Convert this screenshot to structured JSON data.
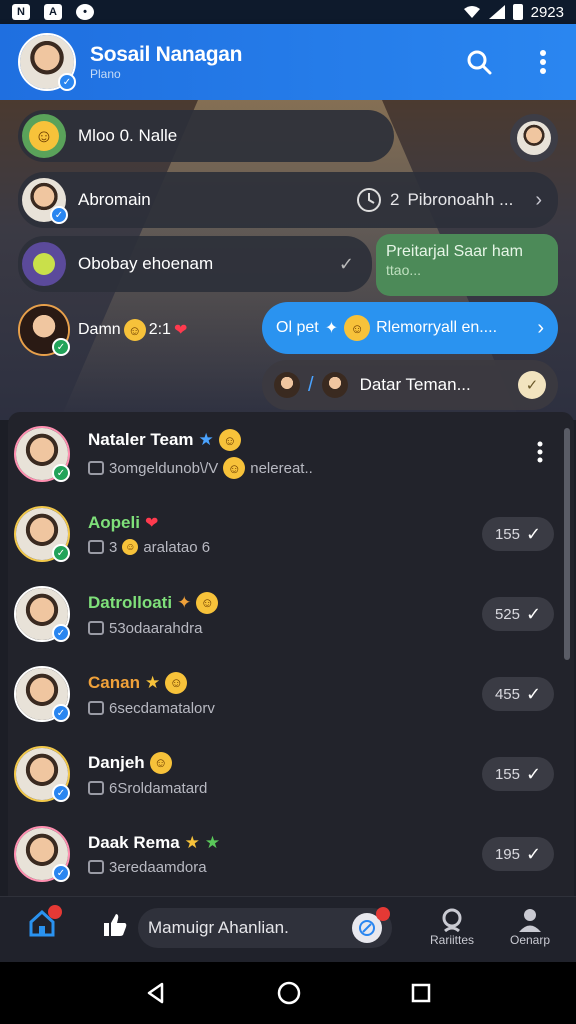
{
  "status_bar": {
    "time": "2923",
    "left_icons": [
      "N",
      "A",
      "•"
    ]
  },
  "header": {
    "title": "Sosail Nanagan",
    "subtitle": "Plano"
  },
  "conversation": {
    "row1": {
      "text": "Mloo 0. Nalle"
    },
    "row2": {
      "name": "Abromain",
      "preview": "Pibronoahh ...",
      "number": "2"
    },
    "row3": {
      "text": "Obobay ehoenam",
      "bubble_text": "Preitarjal Saar ham",
      "bubble_sub": "ttao..."
    },
    "row4": {
      "text": "Damn",
      "count": "2:1"
    },
    "blue_bubble": {
      "text_a": "Ol pet",
      "text_b": "Rlemorryall en...."
    },
    "row5": {
      "text": "Datar Teman..."
    }
  },
  "friends": [
    {
      "name": "Nataler Team",
      "name_color": "#ffffff",
      "sub": "3omgeldunob\\/V",
      "sub2": "nelereat..",
      "count": "",
      "verify": "green"
    },
    {
      "name": "Aopeli",
      "name_color": "#7fe07a",
      "sub": "3",
      "sub2": "aralatao 6",
      "count": "155",
      "verify": "green"
    },
    {
      "name": "Datrolloati",
      "name_color": "#7fe07a",
      "sub": "53odaarahdra",
      "sub2": "",
      "count": "525",
      "verify": "blue"
    },
    {
      "name": "Canan",
      "name_color": "#f0a13a",
      "sub": "6secdamatalorv",
      "sub2": "",
      "count": "455",
      "verify": "blue"
    },
    {
      "name": "Danjeh",
      "name_color": "#ffffff",
      "sub": "6Sroldamatard",
      "sub2": "",
      "count": "155",
      "verify": "blue"
    },
    {
      "name": "Daak Rema",
      "name_color": "#ffffff",
      "sub": "3eredaamdora",
      "sub2": "",
      "count": "195",
      "verify": "blue"
    }
  ],
  "bottom_bar": {
    "composer_text": "Mamuigr Ahanlian.",
    "nav_right_1": "Rariittes",
    "nav_right_2": "Oenarp"
  },
  "colors": {
    "appbar": "#1f6fe0",
    "accent_blue": "#2a93f0",
    "bubble_green": "#4c8a58"
  }
}
